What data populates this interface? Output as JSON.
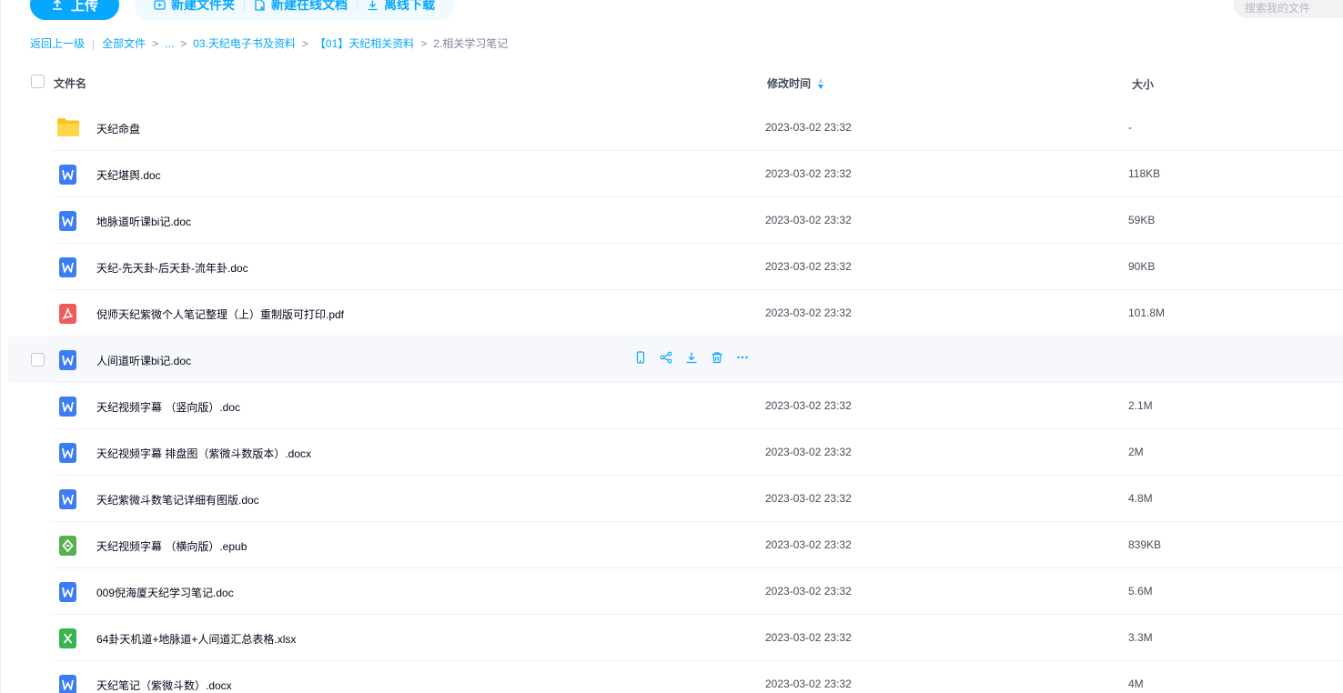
{
  "toolbar": {
    "upload_label": "上传",
    "new_folder_label": "新建文件夹",
    "new_online_doc_label": "新建在线文档",
    "offline_download_label": "离线下载"
  },
  "search": {
    "placeholder": "搜索我的文件"
  },
  "breadcrumb": {
    "back": "返回上一级",
    "items": [
      "全部文件",
      "...",
      "03.天纪电子书及资料",
      "【01】天纪相关资料"
    ],
    "current": "2.相关学习笔记"
  },
  "table": {
    "headers": {
      "name": "文件名",
      "modified": "修改时间",
      "size": "大小"
    },
    "rows": [
      {
        "type": "folder",
        "icon": "folder-icon",
        "name": "天纪命盘",
        "time": "2023-03-02 23:32",
        "size": "-"
      },
      {
        "type": "word",
        "icon": "word-doc-icon",
        "name": "天纪堪舆.doc",
        "time": "2023-03-02 23:32",
        "size": "118KB"
      },
      {
        "type": "word",
        "icon": "word-doc-icon",
        "name": "地脉道听课bi记.doc",
        "time": "2023-03-02 23:32",
        "size": "59KB"
      },
      {
        "type": "word",
        "icon": "word-doc-icon",
        "name": "天纪-先天卦-后天卦-流年卦.doc",
        "time": "2023-03-02 23:32",
        "size": "90KB"
      },
      {
        "type": "pdf",
        "icon": "pdf-icon",
        "name": "倪师天纪紫微个人笔记整理（上）重制版可打印.pdf",
        "time": "2023-03-02 23:32",
        "size": "101.8M"
      },
      {
        "type": "word",
        "icon": "word-doc-icon",
        "name": "人间道听课bi记.doc",
        "time": "",
        "size": "",
        "hover": true
      },
      {
        "type": "word",
        "icon": "word-doc-icon",
        "name": "天纪视频字幕 （竖向版）.doc",
        "time": "2023-03-02 23:32",
        "size": "2.1M"
      },
      {
        "type": "word",
        "icon": "word-doc-icon",
        "name": "天纪视频字幕 排盘图（紫微斗数版本）.docx",
        "time": "2023-03-02 23:32",
        "size": "2M"
      },
      {
        "type": "word",
        "icon": "word-doc-icon",
        "name": "天纪紫微斗数笔记详细有图版.doc",
        "time": "2023-03-02 23:32",
        "size": "4.8M"
      },
      {
        "type": "epub",
        "icon": "epub-icon",
        "name": "天纪视频字幕 （横向版）.epub",
        "time": "2023-03-02 23:32",
        "size": "839KB"
      },
      {
        "type": "word",
        "icon": "word-doc-icon",
        "name": "009倪海厦天纪学习笔记.doc",
        "time": "2023-03-02 23:32",
        "size": "5.6M"
      },
      {
        "type": "excel",
        "icon": "excel-icon",
        "name": "64卦天机道+地脉道+人间道汇总表格.xlsx",
        "time": "2023-03-02 23:32",
        "size": "3.3M"
      },
      {
        "type": "word",
        "icon": "word-doc-icon",
        "name": "天纪笔记（紫微斗数）.docx",
        "time": "2023-03-02 23:32",
        "size": "4M"
      }
    ]
  },
  "colors": {
    "accent": "#06a7ff",
    "word": "#3d7cf5",
    "pdf": "#f05a5a",
    "epub": "#56b04f",
    "excel": "#37b552",
    "folder": "#fcc31d"
  }
}
